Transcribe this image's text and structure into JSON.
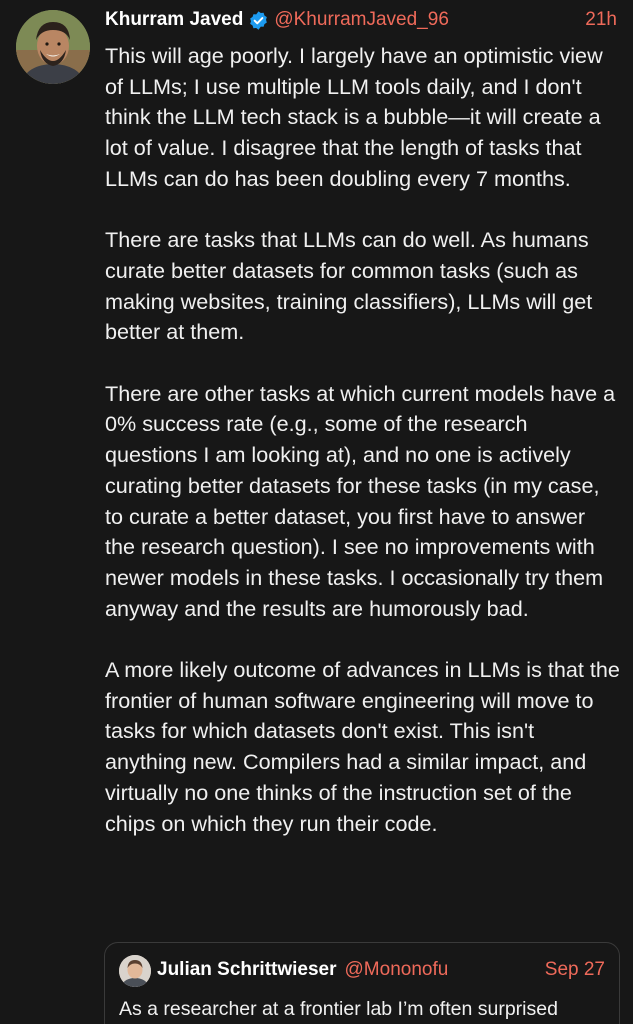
{
  "tweet": {
    "author_name": "Khurram Javed",
    "handle": "@KhurramJaved_96",
    "time": "21h",
    "paragraphs": [
      "This will age poorly. I largely have an optimistic view of LLMs; I use multiple LLM tools daily, and I don't think the LLM tech stack is a bubble—it will create a lot of value. I disagree that the length of tasks that LLMs can do has been doubling every 7 months.",
      "There are tasks that LLMs can do well. As humans curate better datasets for common tasks (such as making websites, training classifiers), LLMs will get better at them.",
      "There are other tasks at which current models have a 0% success rate (e.g., some of the research questions I am looking at), and no one is actively curating better datasets for these tasks (in my case, to curate a better dataset, you first have to answer the research question). I see no improvements with newer models in these tasks. I occasionally try them anyway and the results are humorously bad.",
      "A more likely outcome of advances in LLMs is that the frontier of human software engineering will move to tasks for which datasets don't exist. This isn't anything new. Compilers had a similar impact, and virtually no one thinks of the instruction set of the chips on which they run their code."
    ]
  },
  "quoted_tweet": {
    "author_name": "Julian Schrittwieser",
    "handle": "@Mononofu",
    "date": "Sep 27",
    "text": "As a researcher at a frontier lab I’m often surprised"
  },
  "colors": {
    "background": "#171717",
    "text": "#f0f0f0",
    "accent": "#ef6a5a",
    "verified": "#1d9bf0"
  },
  "icons": {
    "verified": "verified-badge-icon"
  }
}
